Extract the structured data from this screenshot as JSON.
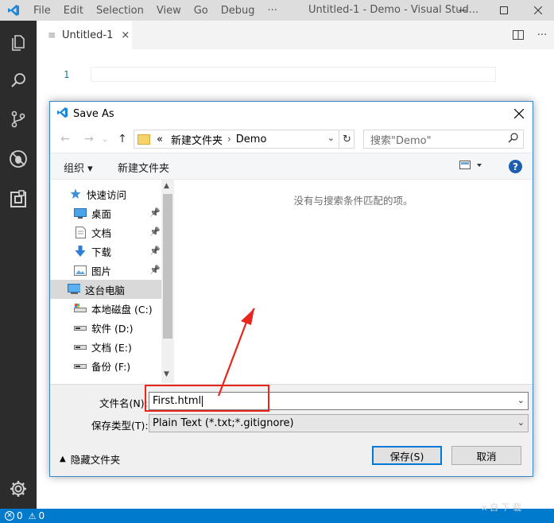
{
  "app": {
    "menu": [
      "File",
      "Edit",
      "Selection",
      "View",
      "Go",
      "Debug",
      "···"
    ],
    "window_title": "Untitled-1 - Demo - Visual Stud..."
  },
  "tab": {
    "label": "Untitled-1",
    "close": "×"
  },
  "editor": {
    "line_number": "1"
  },
  "statusbar": {
    "errors": "0",
    "warnings": "0"
  },
  "dialog": {
    "title": "Save As",
    "address": {
      "prefix": "«",
      "segments": [
        "新建文件夹",
        "Demo"
      ]
    },
    "search_placeholder": "搜索\"Demo\"",
    "toolbar": {
      "organize": "组织 ▾",
      "new_folder": "新建文件夹"
    },
    "tree": [
      {
        "label": "快速访问",
        "icon": "star-icon",
        "pinned": false
      },
      {
        "label": "桌面",
        "icon": "desktop-icon",
        "pinned": true
      },
      {
        "label": "文档",
        "icon": "document-icon",
        "pinned": true
      },
      {
        "label": "下载",
        "icon": "download-icon",
        "pinned": true
      },
      {
        "label": "图片",
        "icon": "picture-icon",
        "pinned": true
      },
      {
        "label": "这台电脑",
        "icon": "computer-icon",
        "pinned": false,
        "selected": true
      },
      {
        "label": "本地磁盘 (C:)",
        "icon": "drive-c-icon",
        "pinned": false
      },
      {
        "label": "软件 (D:)",
        "icon": "drive-icon",
        "pinned": false
      },
      {
        "label": "文档 (E:)",
        "icon": "drive-icon",
        "pinned": false
      },
      {
        "label": "备份 (F:)",
        "icon": "drive-icon",
        "pinned": false
      }
    ],
    "empty_message": "没有与搜索条件匹配的项。",
    "filename_label": "文件名(N):",
    "filename_value": "First.html",
    "filetype_label": "保存类型(T):",
    "filetype_value": "Plain Text (*.txt;*.gitignore)",
    "hide_folders": "隐藏文件夹",
    "save_button": "保存(S)",
    "cancel_button": "取消"
  },
  "watermark": "x 自 下 载",
  "colors": {
    "accent": "#007acc",
    "activity_bar": "#2c2c2c",
    "highlight": "#e8261c",
    "help": "#1c5fb1"
  }
}
